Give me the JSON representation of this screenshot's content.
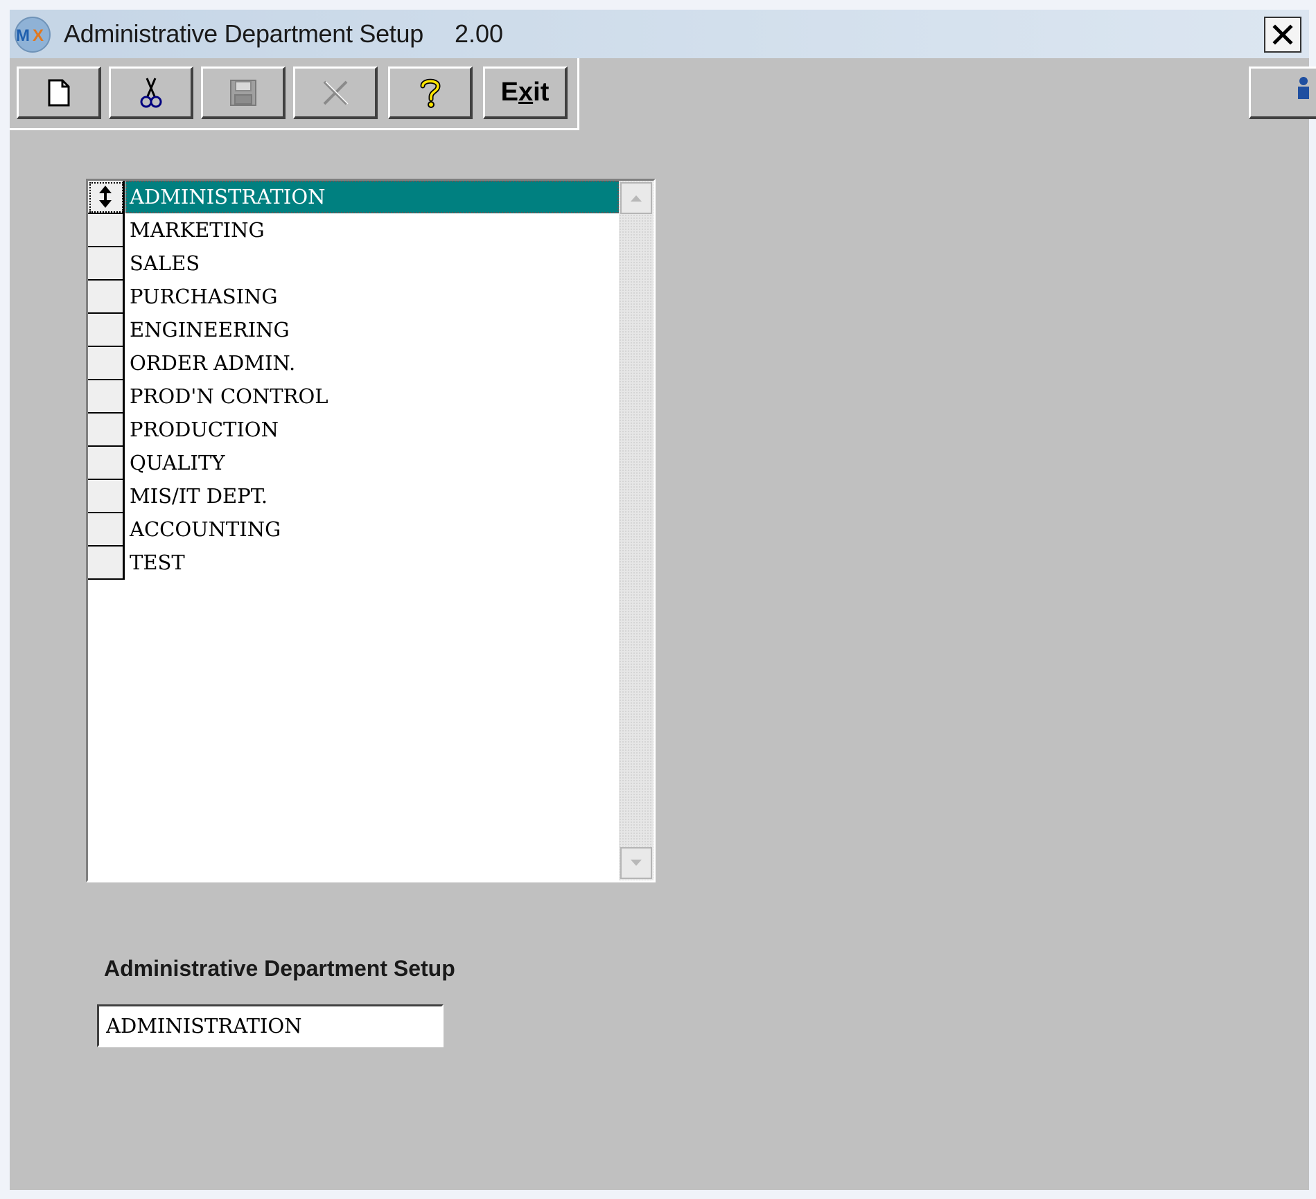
{
  "window": {
    "title": "Administrative Department Setup",
    "version": "2.00",
    "app_icon": "mx-logo-icon",
    "close_icon": "close-icon"
  },
  "toolbar": {
    "buttons": [
      {
        "name": "new",
        "icon": "new-document-icon",
        "enabled": true
      },
      {
        "name": "cut",
        "icon": "scissors-icon",
        "enabled": true
      },
      {
        "name": "save",
        "icon": "floppy-disk-icon",
        "enabled": false
      },
      {
        "name": "delete",
        "icon": "delete-x-icon",
        "enabled": false
      },
      {
        "name": "help",
        "icon": "question-mark-icon",
        "enabled": true
      }
    ],
    "exit_label": "Exit",
    "exit_underline_index": 1
  },
  "department_list": {
    "selected_index": 0,
    "items": [
      "ADMINISTRATION",
      "MARKETING",
      "SALES",
      "PURCHASING",
      "ENGINEERING",
      "ORDER ADMIN.",
      "PROD'N CONTROL",
      "PRODUCTION",
      "QUALITY",
      "MIS/IT DEPT.",
      "ACCOUNTING",
      "TEST"
    ],
    "selected_color": "#008080"
  },
  "form": {
    "label": "Administrative Department Setup",
    "value": "ADMINISTRATION"
  }
}
